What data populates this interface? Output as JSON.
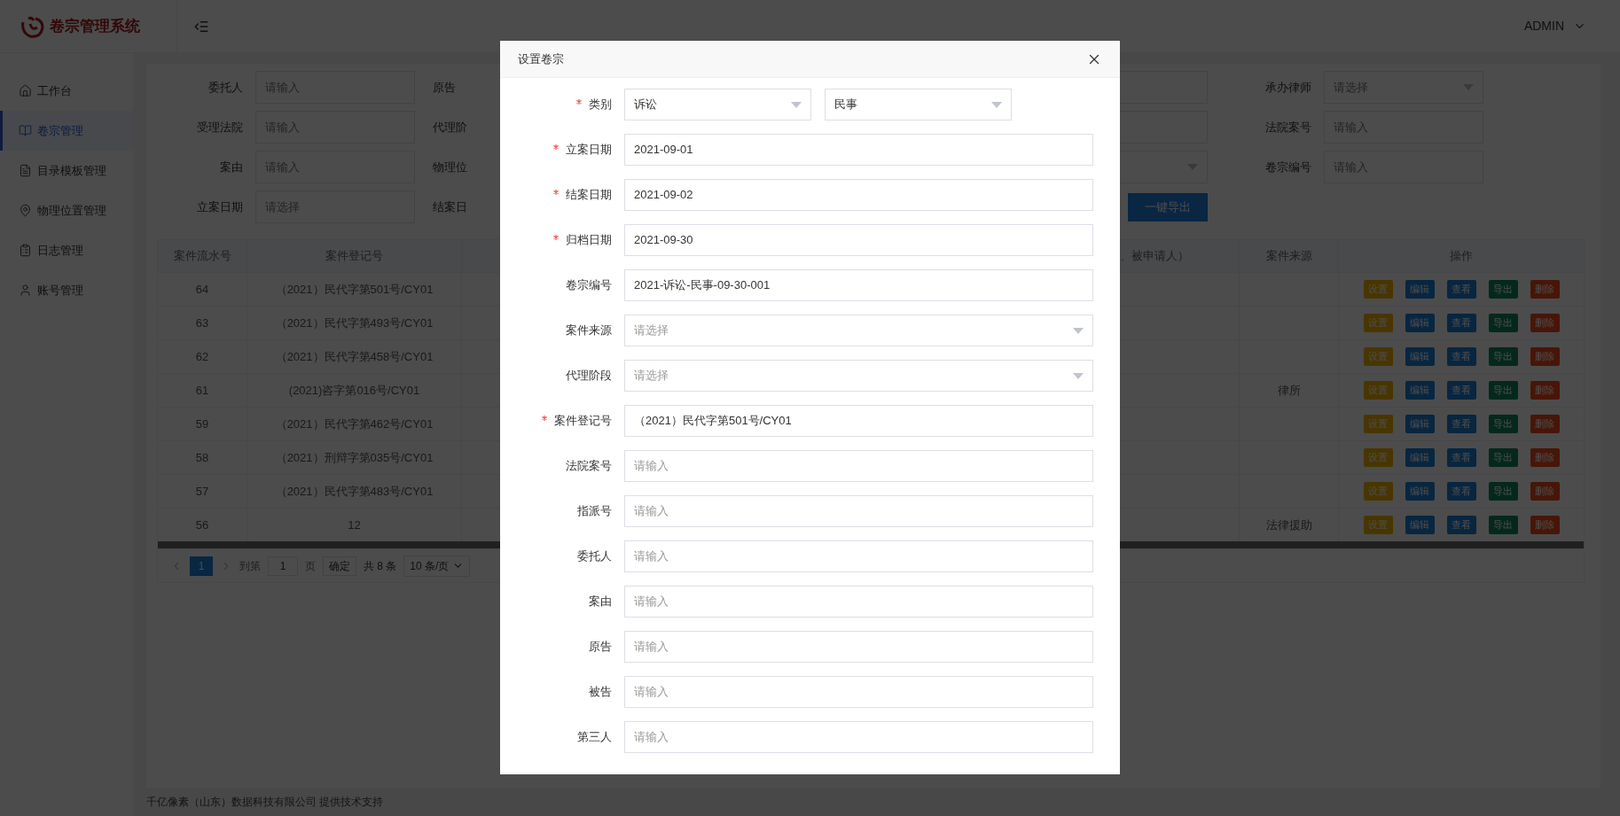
{
  "app": {
    "logo": "卷宗管理系统",
    "user": "ADMIN"
  },
  "sidebar": {
    "items": [
      {
        "label": "工作台",
        "selected": false
      },
      {
        "label": "卷宗管理",
        "selected": true
      },
      {
        "label": "目录模板管理",
        "selected": false
      },
      {
        "label": "物理位置管理",
        "selected": false
      },
      {
        "label": "日志管理",
        "selected": false
      },
      {
        "label": "账号管理",
        "selected": false
      }
    ]
  },
  "filters": {
    "rows": [
      {
        "left": {
          "label": "委托人",
          "placeholder": "请输入"
        },
        "middle_label": "原告",
        "middle_field": {
          "kind": "input"
        },
        "right": {
          "label": "承办律师",
          "placeholder": "请选择",
          "kind": "select"
        }
      },
      {
        "left": {
          "label": "受理法院",
          "placeholder": "请输入"
        },
        "middle_label": "代理阶",
        "middle_field": {
          "kind": "input"
        },
        "right": {
          "label": "法院案号",
          "placeholder": "请输入",
          "kind": "input"
        }
      },
      {
        "left": {
          "label": "案由",
          "placeholder": "请输入"
        },
        "middle_label": "物理位",
        "middle_field": {
          "kind": "select"
        },
        "right": {
          "label": "卷宗编号",
          "placeholder": "请输入",
          "kind": "input"
        }
      },
      {
        "left": {
          "label": "立案日期",
          "placeholder": "请选择"
        },
        "middle_label": "结案日",
        "middle_field": {
          "kind": "button"
        },
        "right": null
      }
    ],
    "export_button": "一键导出"
  },
  "table": {
    "columns": [
      "案件流水号",
      "案件登记号",
      "、被申请人）",
      "案件来源",
      "操作"
    ],
    "rows": [
      {
        "serial": "64",
        "reg_no": "（2021）民代字第501号/CY01",
        "actions": [
          {
            "label": "设置",
            "kind": "warning"
          },
          {
            "label": "编辑",
            "kind": "primary"
          },
          {
            "label": "查看",
            "kind": "primary"
          },
          {
            "label": "导出",
            "kind": "success"
          },
          {
            "label": "删除",
            "kind": "danger"
          }
        ]
      },
      {
        "serial": "63",
        "reg_no": "（2021）民代字第493号/CY01",
        "actions": [
          {
            "label": "设置",
            "kind": "warning"
          },
          {
            "label": "编辑",
            "kind": "primary"
          },
          {
            "label": "查看",
            "kind": "primary"
          },
          {
            "label": "导出",
            "kind": "success"
          },
          {
            "label": "删除",
            "kind": "danger"
          }
        ]
      },
      {
        "serial": "62",
        "reg_no": "（2021）民代字第458号/CY01",
        "actions": [
          {
            "label": "设置",
            "kind": "warning"
          },
          {
            "label": "编辑",
            "kind": "primary"
          },
          {
            "label": "查看",
            "kind": "primary"
          },
          {
            "label": "导出",
            "kind": "success"
          },
          {
            "label": "删除",
            "kind": "danger"
          }
        ]
      },
      {
        "serial": "61",
        "reg_no": "(2021)咨字第016号/CY01",
        "source": "律所",
        "actions": [
          {
            "label": "设置",
            "kind": "warning"
          },
          {
            "label": "编辑",
            "kind": "primary"
          },
          {
            "label": "查看",
            "kind": "primary"
          },
          {
            "label": "导出",
            "kind": "success"
          },
          {
            "label": "删除",
            "kind": "danger"
          }
        ]
      },
      {
        "serial": "59",
        "reg_no": "（2021）民代字第462号/CY01",
        "actions": [
          {
            "label": "设置",
            "kind": "warning"
          },
          {
            "label": "编辑",
            "kind": "primary"
          },
          {
            "label": "查看",
            "kind": "primary"
          },
          {
            "label": "导出",
            "kind": "success"
          },
          {
            "label": "删除",
            "kind": "danger"
          }
        ]
      },
      {
        "serial": "58",
        "reg_no": "（2021）刑辩字第035号/CY01",
        "actions": [
          {
            "label": "设置",
            "kind": "warning"
          },
          {
            "label": "编辑",
            "kind": "primary"
          },
          {
            "label": "查看",
            "kind": "primary"
          },
          {
            "label": "导出",
            "kind": "success"
          },
          {
            "label": "删除",
            "kind": "danger"
          }
        ]
      },
      {
        "serial": "57",
        "reg_no": "（2021）民代字第483号/CY01",
        "actions": [
          {
            "label": "设置",
            "kind": "warning"
          },
          {
            "label": "编辑",
            "kind": "primary"
          },
          {
            "label": "查看",
            "kind": "primary"
          },
          {
            "label": "导出",
            "kind": "success"
          },
          {
            "label": "删除",
            "kind": "danger"
          }
        ]
      },
      {
        "serial": "56",
        "reg_no": "12",
        "source": "法律援助",
        "actions": [
          {
            "label": "设置",
            "kind": "warning"
          },
          {
            "label": "编辑",
            "kind": "primary"
          },
          {
            "label": "查看",
            "kind": "primary"
          },
          {
            "label": "导出",
            "kind": "success"
          },
          {
            "label": "删除",
            "kind": "danger"
          }
        ]
      }
    ]
  },
  "pagination": {
    "page": "1",
    "goto_label": "到第",
    "goto_value": "1",
    "page_unit": "页",
    "confirm": "确定",
    "total": "共 8 条",
    "page_size": "10 条/页"
  },
  "footer": "千亿像素（山东）数据科技有限公司 提供技术支持",
  "dialog": {
    "title": "设置卷宗",
    "fields": [
      {
        "label": "类别",
        "required": true,
        "kind": "pair",
        "options": [
          {
            "value": "诉讼"
          },
          {
            "value": "民事"
          }
        ]
      },
      {
        "label": "立案日期",
        "required": true,
        "kind": "input",
        "value": "2021-09-01"
      },
      {
        "label": "结案日期",
        "required": true,
        "kind": "input",
        "value": "2021-09-02"
      },
      {
        "label": "归档日期",
        "required": true,
        "kind": "input",
        "value": "2021-09-30"
      },
      {
        "label": "卷宗编号",
        "required": false,
        "kind": "input",
        "value": "2021-诉讼-民事-09-30-001"
      },
      {
        "label": "案件来源",
        "required": false,
        "kind": "select",
        "placeholder": "请选择"
      },
      {
        "label": "代理阶段",
        "required": false,
        "kind": "select",
        "placeholder": "请选择"
      },
      {
        "label": "案件登记号",
        "required": true,
        "kind": "input",
        "value": "（2021）民代字第501号/CY01"
      },
      {
        "label": "法院案号",
        "required": false,
        "kind": "input",
        "placeholder": "请输入"
      },
      {
        "label": "指派号",
        "required": false,
        "kind": "input",
        "placeholder": "请输入"
      },
      {
        "label": "委托人",
        "required": false,
        "kind": "input",
        "placeholder": "请输入"
      },
      {
        "label": "案由",
        "required": false,
        "kind": "input",
        "placeholder": "请输入"
      },
      {
        "label": "原告",
        "required": false,
        "kind": "input",
        "placeholder": "请输入"
      },
      {
        "label": "被告",
        "required": false,
        "kind": "input",
        "placeholder": "请输入"
      },
      {
        "label": "第三人",
        "required": false,
        "kind": "input",
        "placeholder": "请输入"
      }
    ]
  }
}
